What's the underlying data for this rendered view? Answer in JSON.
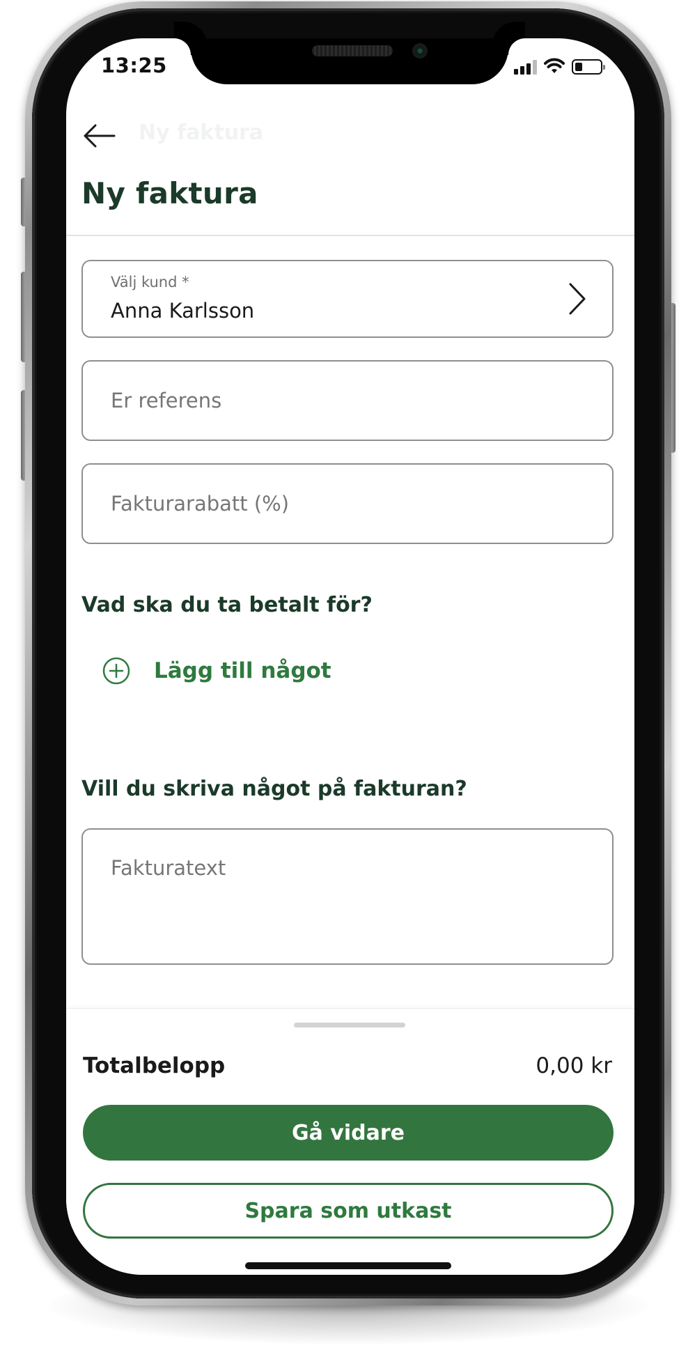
{
  "status_bar": {
    "time": "13:25",
    "icons": [
      "cellular-signal-icon",
      "wifi-icon",
      "battery-icon"
    ]
  },
  "header": {
    "back_icon": "arrow-left-icon",
    "faded_title": "Ny faktura",
    "title": "Ny faktura"
  },
  "form": {
    "customer": {
      "label": "Välj kund *",
      "value": "Anna Karlsson",
      "icon": "chevron-right-icon"
    },
    "reference": {
      "placeholder": "Er referens"
    },
    "discount": {
      "placeholder": "Fakturarabatt (%)"
    },
    "items_section": {
      "title": "Vad ska du ta betalt för?",
      "add_label": "Lägg till något",
      "add_icon": "plus-circle-icon"
    },
    "text_section": {
      "title": "Vill du skriva något på fakturan?",
      "placeholder": "Fakturatext"
    }
  },
  "summary": {
    "total_label": "Totalbelopp",
    "total_value": "0,00 kr"
  },
  "actions": {
    "primary_label": "Gå vidare",
    "secondary_label": "Spara som utkast"
  },
  "colors": {
    "brand_green": "#33753f",
    "heading_dark_green": "#1b3a2a",
    "field_border": "#8f8f8f"
  }
}
